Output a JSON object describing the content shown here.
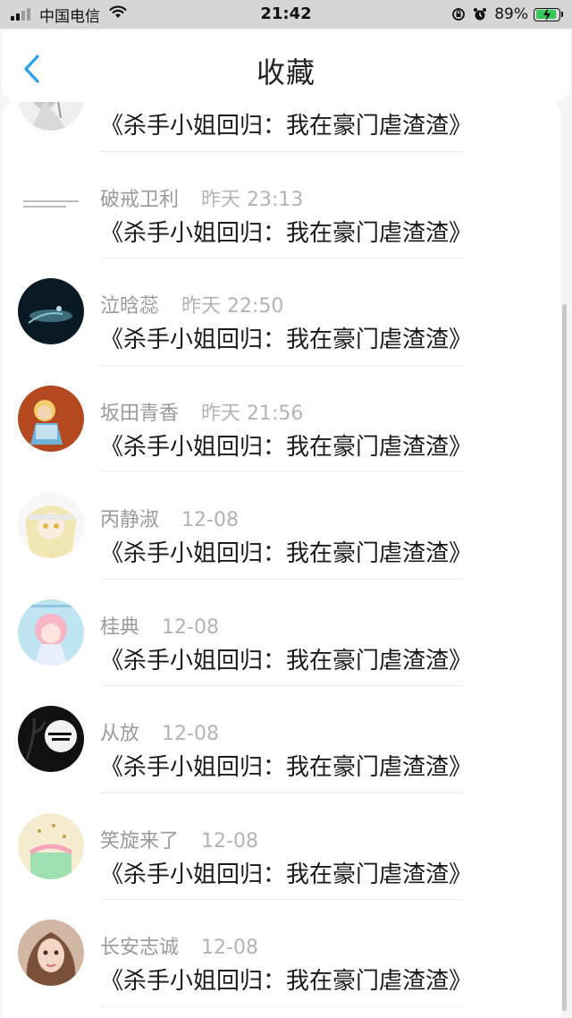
{
  "status_bar": {
    "carrier": "中国电信",
    "time": "21:42",
    "battery": "89%",
    "battery_level": 0.89
  },
  "nav": {
    "title": "收藏"
  },
  "favorites": [
    {
      "name": "",
      "time": "",
      "content": "《杀手小姐回归：我在豪门虐渣渣》",
      "avatar": "sketch-avatar"
    },
    {
      "name": "破戒卫利",
      "time": "昨天 23:13",
      "content": "《杀手小姐回归：我在豪门虐渣渣》",
      "avatar": "text-note-avatar"
    },
    {
      "name": "泣晗蕊",
      "time": "昨天 22:50",
      "content": "《杀手小姐回归：我在豪门虐渣渣》",
      "avatar": "night-sea-avatar"
    },
    {
      "name": "坂田青香",
      "time": "昨天 21:56",
      "content": "《杀手小姐回归：我在豪门虐渣渣》",
      "avatar": "cartoon-girl-avatar"
    },
    {
      "name": "丙静淑",
      "time": "12-08",
      "content": "《杀手小姐回归：我在豪门虐渣渣》",
      "avatar": "anime-blonde-avatar"
    },
    {
      "name": "桂典",
      "time": "12-08",
      "content": "《杀手小姐回归：我在豪门虐渣渣》",
      "avatar": "anime-pink-avatar"
    },
    {
      "name": "从放",
      "time": "12-08",
      "content": "《杀手小姐回归：我在豪门虐渣渣》",
      "avatar": "halloween-avatar"
    },
    {
      "name": "笑旋来了",
      "time": "12-08",
      "content": "《杀手小姐回归：我在豪门虐渣渣》",
      "avatar": "pastel-pattern-avatar"
    },
    {
      "name": "长安志诚",
      "time": "12-08",
      "content": "《杀手小姐回归：我在豪门虐渣渣》",
      "avatar": "selfie-photo-avatar"
    }
  ],
  "colors": {
    "accent": "#2aa0f0",
    "name_gray": "#9a9a9a",
    "content": "#1a1a1a",
    "battery_green": "#34c759"
  }
}
